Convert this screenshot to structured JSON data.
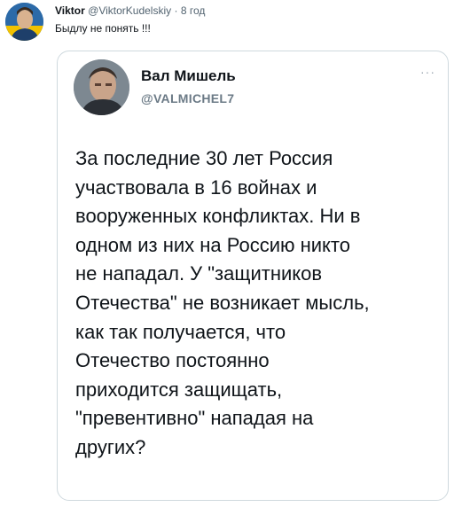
{
  "tweet": {
    "author_name": "Viktor",
    "author_handle": "@ViktorKudelskiy",
    "separator": "·",
    "time": "8 год",
    "text": "Быдлу не понять !!!"
  },
  "quoted": {
    "name": "Вал Мишель",
    "handle": "@VALMICHEL7",
    "more_label": "···",
    "lines": [
      "За последние 30 лет Россия",
      "участвовала в 16 войнах и",
      "вооруженных конфликтах. Ни в",
      "одном из них на Россию никто",
      "не нападал. У \"защитников",
      "Отечества\" не возникает мысль,",
      "как так получается, что",
      "Отечество постоянно",
      "приходится защищать,",
      "\"превентивно\" нападая на",
      "других?"
    ]
  },
  "icons": {
    "avatar": "user-avatar",
    "inner_avatar": "quoted-user-avatar",
    "more": "more-options-icon"
  },
  "colors": {
    "text_primary": "#0f1419",
    "text_secondary": "#536471",
    "border": "#cfd9de",
    "avatar_blue": "#2c6aa8",
    "avatar_yellow": "#f2c200"
  }
}
